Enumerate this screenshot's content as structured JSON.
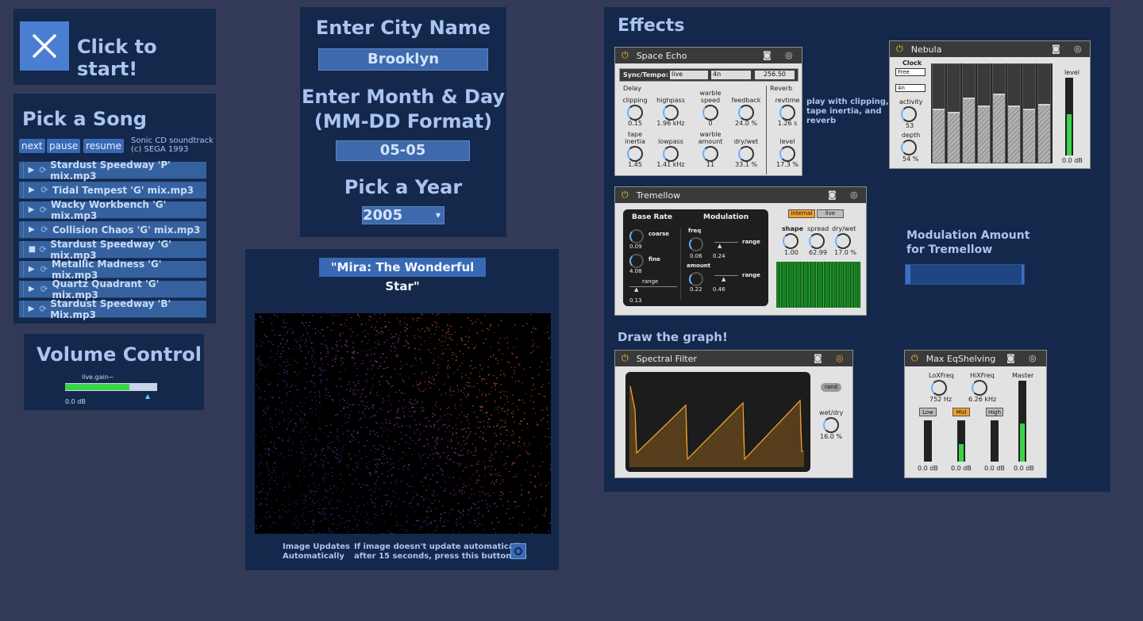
{
  "start": {
    "label": "Click to start!",
    "icon": "close-icon"
  },
  "songs": {
    "title": "Pick a Song",
    "buttons": [
      "next",
      "pause",
      "resume"
    ],
    "credit": [
      "Sonic CD soundtrack",
      "(c) SEGA 1993"
    ],
    "list": [
      {
        "name": "Stardust Speedway 'P' mix.mp3",
        "state": "play"
      },
      {
        "name": "Tidal Tempest 'G' mix.mp3",
        "state": "play"
      },
      {
        "name": "Wacky Workbench 'G' mix.mp3",
        "state": "play"
      },
      {
        "name": "Collision Chaos 'G' mix.mp3",
        "state": "play"
      },
      {
        "name": "Stardust Speedway 'G' mix.mp3",
        "state": "stop"
      },
      {
        "name": "Metallic Madness 'G' mix.mp3",
        "state": "play"
      },
      {
        "name": "Quartz Quadrant 'G' mix.mp3",
        "state": "play"
      },
      {
        "name": "Stardust Speedway 'B' Mix.mp3",
        "state": "play"
      }
    ]
  },
  "volume": {
    "title": "Volume Control",
    "object": "live.gain~",
    "value": "0.0 dB",
    "level": 0.7
  },
  "city": {
    "title": "Enter City Name",
    "value": "Brooklyn",
    "date_title_1": "Enter Month & Day",
    "date_title_2": "(MM-DD Format)",
    "date_value": "05-05",
    "year_title": "Pick a Year",
    "year_value": "2005"
  },
  "image": {
    "song_name": "\"Mira: The Wonderful Star\"",
    "auto_1": "Image Updates",
    "auto_2": "Automatically",
    "help_1": "If image doesn't update automatically",
    "help_2": "after 15 seconds, press this button -->"
  },
  "effects": {
    "title": "Effects",
    "draw_title": "Draw the graph!",
    "mod_label_1": "Modulation Amount",
    "mod_label_2": "for Tremellow",
    "note": [
      "play with clipping,",
      "tape inertia, and",
      "reverb"
    ],
    "space_echo": {
      "name": "Space Echo",
      "sync_label": "Sync/Tempo:",
      "sync_mode": "live",
      "sync_div": "4n",
      "tempo": "256.50",
      "delay_label": "Delay",
      "reverb_label": "Reverb",
      "knobs": [
        {
          "label": "clipping",
          "value": "0.15"
        },
        {
          "label": "highpass",
          "value": "1.96 kHz"
        },
        {
          "label": "warble speed",
          "value": "0"
        },
        {
          "label": "feedback",
          "value": "24.0 %"
        },
        {
          "label": "revtime",
          "value": "1.26 s"
        },
        {
          "label": "tape inertia",
          "value": "1.45"
        },
        {
          "label": "lowpass",
          "value": "1.41 kHz"
        },
        {
          "label": "warble amount",
          "value": "11"
        },
        {
          "label": "dry/wet",
          "value": "33.1 %"
        },
        {
          "label": "level",
          "value": "17.3 %"
        }
      ]
    },
    "nebula": {
      "name": "Nebula",
      "clock_label": "Clock",
      "clock_mode": "Free",
      "clock_div": "4n",
      "activity_label": "activity",
      "activity_value": "53",
      "depth_label": "depth",
      "depth_value": "54 %",
      "level_label": "level",
      "level_value": "0.0 dB",
      "sliders": [
        0.55,
        0.52,
        0.66,
        0.58,
        0.7,
        0.58,
        0.55,
        0.6
      ]
    },
    "tremellow": {
      "name": "Tremellow",
      "base_rate": "Base Rate",
      "modulation": "Modulation",
      "coarse_label": "coarse",
      "coarse_value": "0.09",
      "fine_label": "fine",
      "fine_value": "4.08",
      "range_label": "range",
      "range_value": "0.13",
      "freq_label": "freq",
      "freq_value": "0.06",
      "freq_range_value": "0.24",
      "amount_label": "amount",
      "amount_value": "0.22",
      "amount_range_value": "0.46",
      "mod_range_label": "range",
      "mode_internal": "internal",
      "mode_live": "live",
      "shape_label": "shape",
      "shape_value": "1.00",
      "spread_label": "spread",
      "spread_value": "62.99",
      "drywet_label": "dry/wet",
      "drywet_value": "17.0 %"
    },
    "spectral": {
      "name": "Spectral Filter",
      "rand_label": "rand",
      "wetdry_label": "wet/dry",
      "wetdry_value": "16.0 %"
    },
    "eq": {
      "name": "Max EqShelving",
      "loxfreq_label": "LoXFreq",
      "loxfreq_value": "752 Hz",
      "hixfreq_label": "HiXFreq",
      "hixfreq_value": "6.26 kHz",
      "master_label": "Master",
      "bands": [
        {
          "label": "Low",
          "value": "0.0 dB",
          "active": false
        },
        {
          "label": "Mid",
          "value": "0.0 dB",
          "active": true
        },
        {
          "label": "High",
          "value": "0.0 dB",
          "active": false
        }
      ],
      "master_value": "0.0 dB"
    }
  },
  "colors": {
    "background": "#333a57",
    "panel": "#14284b",
    "accent": "#4a7ed1",
    "heading": "#a9c4f0",
    "device_orange": "#f0a030"
  }
}
